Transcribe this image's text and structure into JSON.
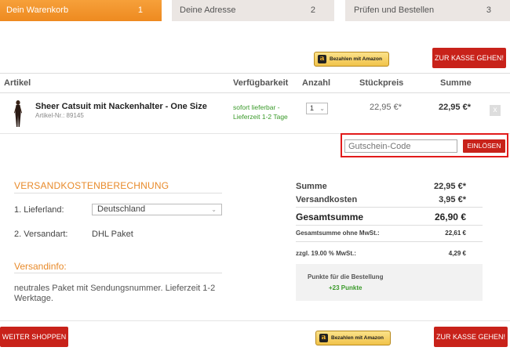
{
  "steps": [
    {
      "label": "Dein Warenkorb",
      "num": "1"
    },
    {
      "label": "Deine Adresse",
      "num": "2"
    },
    {
      "label": "Prüfen und Bestellen",
      "num": "3"
    }
  ],
  "amazon_pay": {
    "label": "Bezahlen mit Amazon",
    "logo": "a"
  },
  "checkout_label": "ZUR KASSE GEHEN!",
  "table": {
    "headers": {
      "article": "Artikel",
      "availability": "Verfügbarkeit",
      "quantity": "Anzahl",
      "unit_price": "Stückpreis",
      "sum": "Summe"
    }
  },
  "item": {
    "name": "Sheer Catsuit mit Nackenhalter - One Size",
    "article_no": "Artikel-Nr.: 89145",
    "availability": "sofort lieferbar - Lieferzeit 1-2 Tage",
    "quantity": "1",
    "unit_price": "22,95 €*",
    "sum": "22,95 €*",
    "remove": "x"
  },
  "voucher": {
    "placeholder": "Gutschein-Code",
    "button": "EINLÖSEN"
  },
  "shipping": {
    "title": "VERSANDKOSTENBERECHNUNG",
    "country_label": "1. Lieferland:",
    "country_value": "Deutschland",
    "method_label": "2. Versandart:",
    "method_value": "DHL Paket",
    "info_title": "Versandinfo:",
    "info_text": "neutrales Paket mit Sendungsnummer. Lieferzeit 1-2 Werktage."
  },
  "totals": {
    "sum_label": "Summe",
    "sum_value": "22,95 €*",
    "shipping_label": "Versandkosten",
    "shipping_value": "3,95 €*",
    "grand_label": "Gesamtsumme",
    "grand_value": "26,90 €",
    "net_label": "Gesamtsumme ohne MwSt.:",
    "net_value": "22,61 €",
    "vat_label": "zzgl. 19.00 % MwSt.:",
    "vat_value": "4,29 €"
  },
  "points": {
    "label": "Punkte für die Bestellung",
    "value": "+23 Punkte"
  },
  "continue_label": "WEITER SHOPPEN",
  "colors": {
    "accent_orange": "#ee8a20",
    "button_red": "#c8221a",
    "highlight_red": "#e21b1b",
    "available_green": "#3a9a2a"
  }
}
